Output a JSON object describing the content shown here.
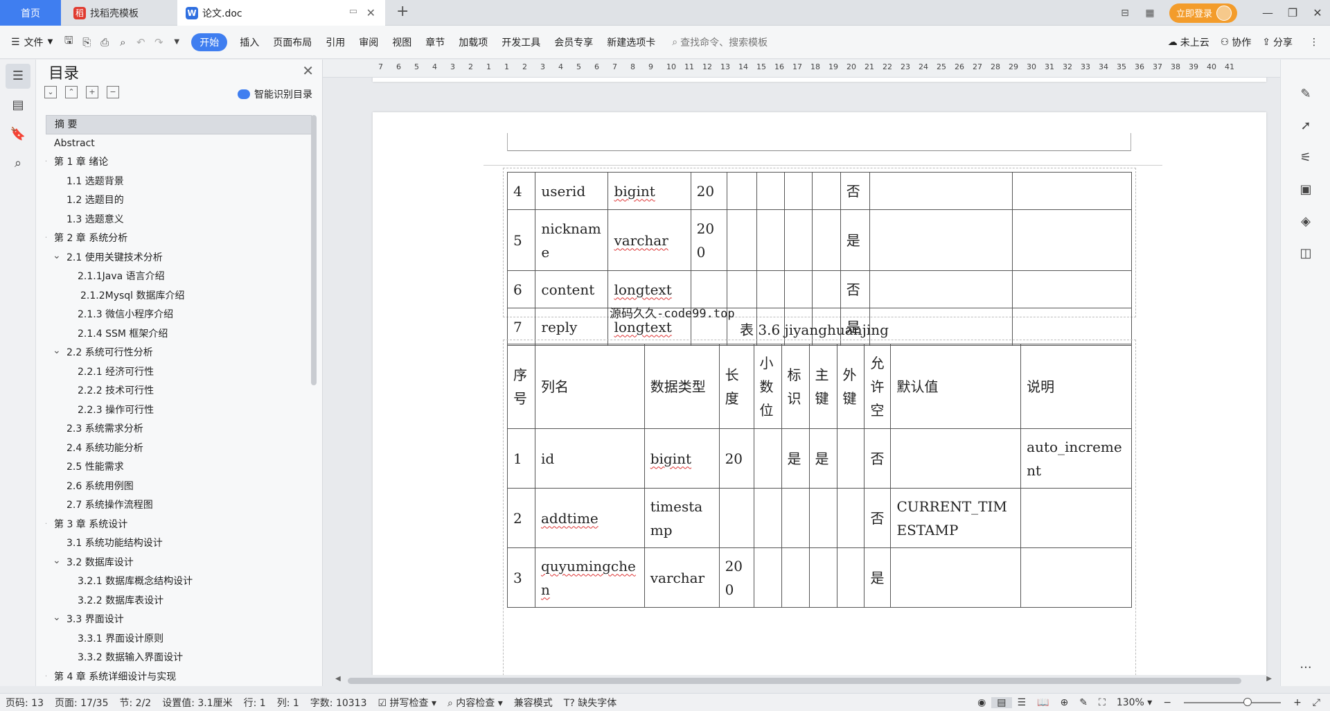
{
  "tabs": {
    "home": "首页",
    "template": "找稻壳模板",
    "doc": "论文.doc"
  },
  "top_right": {
    "login": "立即登录"
  },
  "toolbar": {
    "file": "文件",
    "menus": [
      "开始",
      "插入",
      "页面布局",
      "引用",
      "审阅",
      "视图",
      "章节",
      "加载项",
      "开发工具",
      "会员专享",
      "新建选项卡"
    ],
    "search_placeholder": "查找命令、搜索模板",
    "cloud": "未上云",
    "collab": "协作",
    "share": "分享"
  },
  "toc": {
    "title": "目录",
    "smart": "智能识别目录",
    "items": [
      {
        "text": "摘  要",
        "level": 0,
        "selected": true
      },
      {
        "text": "Abstract",
        "level": 0
      },
      {
        "text": "第 1 章   绪论",
        "level": 0,
        "expand": true
      },
      {
        "text": "1.1 选题背景",
        "level": 1
      },
      {
        "text": "1.2 选题目的",
        "level": 1
      },
      {
        "text": "1.3 选题意义",
        "level": 1
      },
      {
        "text": "第 2 章  系统分析",
        "level": 0,
        "expand": true
      },
      {
        "text": "2.1 使用关键技术分析",
        "level": 1,
        "expand": true
      },
      {
        "text": "2.1.1Java 语言介绍",
        "level": 2
      },
      {
        "text": "2.1.2Mysql 数据库介绍",
        "level": 2,
        "shift": true
      },
      {
        "text": "2.1.3 微信小程序介绍",
        "level": 2
      },
      {
        "text": "2.1.4 SSM 框架介绍",
        "level": 2
      },
      {
        "text": "2.2 系统可行性分析",
        "level": 1,
        "expand": true
      },
      {
        "text": "2.2.1 经济可行性",
        "level": 2
      },
      {
        "text": "2.2.2 技术可行性",
        "level": 2
      },
      {
        "text": "2.2.3 操作可行性",
        "level": 2
      },
      {
        "text": "2.3 系统需求分析",
        "level": 1
      },
      {
        "text": "2.4 系统功能分析",
        "level": 1
      },
      {
        "text": "2.5 性能需求",
        "level": 1
      },
      {
        "text": "2.6 系统用例图",
        "level": 1
      },
      {
        "text": "2.7 系统操作流程图",
        "level": 1
      },
      {
        "text": "第 3 章  系统设计",
        "level": 0,
        "expand": true
      },
      {
        "text": "3.1 系统功能结构设计",
        "level": 1
      },
      {
        "text": "3.2 数据库设计",
        "level": 1,
        "expand": true
      },
      {
        "text": "3.2.1 数据库概念结构设计",
        "level": 2
      },
      {
        "text": "3.2.2 数据库表设计",
        "level": 2
      },
      {
        "text": "3.3 界面设计",
        "level": 1,
        "expand": true
      },
      {
        "text": "3.3.1 界面设计原则",
        "level": 2
      },
      {
        "text": "3.3.2 数据输入界面设计",
        "level": 2
      },
      {
        "text": "第 4 章  系统详细设计与实现",
        "level": 0,
        "expand": true
      }
    ]
  },
  "ruler_ticks": [
    "7",
    "6",
    "5",
    "4",
    "3",
    "2",
    "1",
    "1",
    "2",
    "3",
    "4",
    "5",
    "6",
    "7",
    "8",
    "9",
    "10",
    "11",
    "12",
    "13",
    "14",
    "15",
    "16",
    "17",
    "18",
    "19",
    "20",
    "21",
    "22",
    "23",
    "24",
    "25",
    "26",
    "27",
    "28",
    "29",
    "30",
    "31",
    "32",
    "33",
    "34",
    "35",
    "36",
    "37",
    "38",
    "39",
    "40",
    "41"
  ],
  "document": {
    "table1_rows": [
      [
        "4",
        "userid",
        "bigint",
        "20",
        "",
        "",
        "",
        "",
        "否",
        "",
        ""
      ],
      [
        "5",
        "nickname",
        "varchar",
        "200",
        "",
        "",
        "",
        "",
        "是",
        "",
        ""
      ],
      [
        "6",
        "content",
        "longtext",
        "",
        "",
        "",
        "",
        "",
        "否",
        "",
        ""
      ],
      [
        "7",
        "reply",
        "longtext",
        "",
        "",
        "",
        "",
        "",
        "是",
        "",
        ""
      ]
    ],
    "watermark": "源码久久-code99.top",
    "caption": "表 3.6 jiyanghuanjing",
    "table2_header": [
      "序号",
      "列名",
      "数据类型",
      "长度",
      "小数位",
      "标识",
      "主键",
      "外键",
      "允许空",
      "默认值",
      "说明"
    ],
    "table2_rows": [
      [
        "1",
        "id",
        "bigint",
        "20",
        "",
        "是",
        "是",
        "",
        "否",
        "",
        "auto_increment"
      ],
      [
        "2",
        "addtime",
        "timestamp",
        "",
        "",
        "",
        "",
        "",
        "否",
        "CURRENT_TIMESTAMP",
        ""
      ],
      [
        "3",
        "quyumingchen",
        "varchar",
        "200",
        "",
        "",
        "",
        "",
        "是",
        "",
        ""
      ]
    ]
  },
  "status": {
    "page_code": "页码: 13",
    "page": "页面: 17/35",
    "section": "节: 2/2",
    "setting": "设置值: 3.1厘米",
    "row": "行: 1",
    "col": "列: 1",
    "words": "字数: 10313",
    "spell": "拼写检查",
    "content_check": "内容检查",
    "compat": "兼容模式",
    "missing_font": "缺失字体",
    "zoom": "130%"
  }
}
